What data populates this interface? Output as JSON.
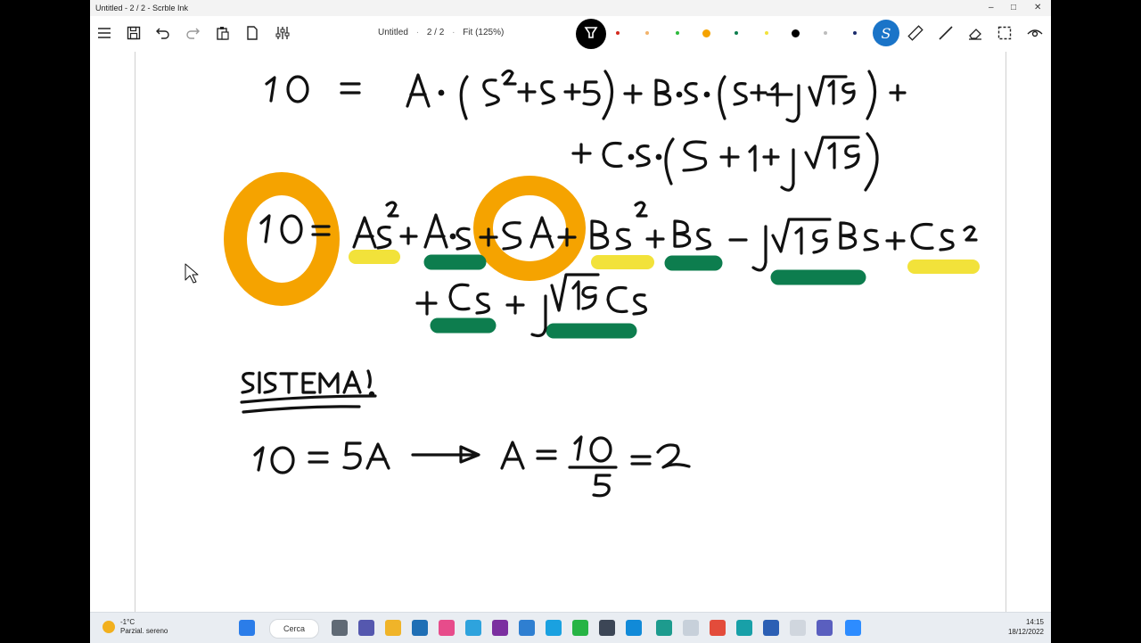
{
  "window": {
    "title": "Untitled - 2 / 2 - Scrble Ink"
  },
  "toolbar": {
    "doc_name": "Untitled",
    "page": "2 / 2",
    "zoom": "Fit (125%)",
    "pen_colors": [
      "#d42a1e",
      "#f2b36b",
      "#2dba3c",
      "#f5a300",
      "#0d7d4e",
      "#f2e23a",
      "#000000",
      "#bdbdbd",
      "#1a2b6b"
    ],
    "selected_tool_letter": "S"
  },
  "taskbar": {
    "temperature": "-1°C",
    "weather": "Parzial. sereno",
    "search_label": "Cerca",
    "time": "14:15",
    "date": "18/12/2022"
  }
}
